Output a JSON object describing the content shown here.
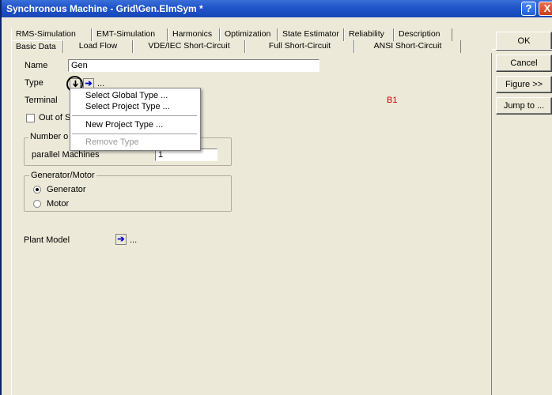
{
  "window": {
    "title": "Synchronous Machine - Grid\\Gen.ElmSym *",
    "help_label": "?",
    "close_label": "X"
  },
  "tabs_row1": [
    "RMS-Simulation",
    "EMT-Simulation",
    "Harmonics",
    "Optimization",
    "State Estimator",
    "Reliability",
    "Description"
  ],
  "tabs_row2": [
    "Basic Data",
    "Load Flow",
    "VDE/IEC Short-Circuit",
    "Full Short-Circuit",
    "ANSI Short-Circuit"
  ],
  "buttons": {
    "ok": "OK",
    "cancel": "Cancel",
    "figure": "Figure >>",
    "jump": "Jump to ..."
  },
  "form": {
    "name_label": "Name",
    "name_value": "Gen",
    "type_label": "Type",
    "type_ellipsis": "...",
    "terminal_label": "Terminal",
    "terminal_value": "B1",
    "out_of_service_label": "Out of S",
    "number_group_title": "Number o",
    "parallel_label": "parallel Machines",
    "parallel_value": "1",
    "genmotor_title": "Generator/Motor",
    "generator_label": "Generator",
    "motor_label": "Motor",
    "mode_selected": "Generator",
    "plant_model_label": "Plant Model",
    "plant_ellipsis": "..."
  },
  "context_menu": {
    "items": [
      "Select Global Type ...",
      "Select Project Type ...",
      "New Project Type ...",
      "Remove Type"
    ],
    "disabled": [
      "Remove Type"
    ]
  },
  "icons": {
    "arrow_glyph": "➔"
  }
}
